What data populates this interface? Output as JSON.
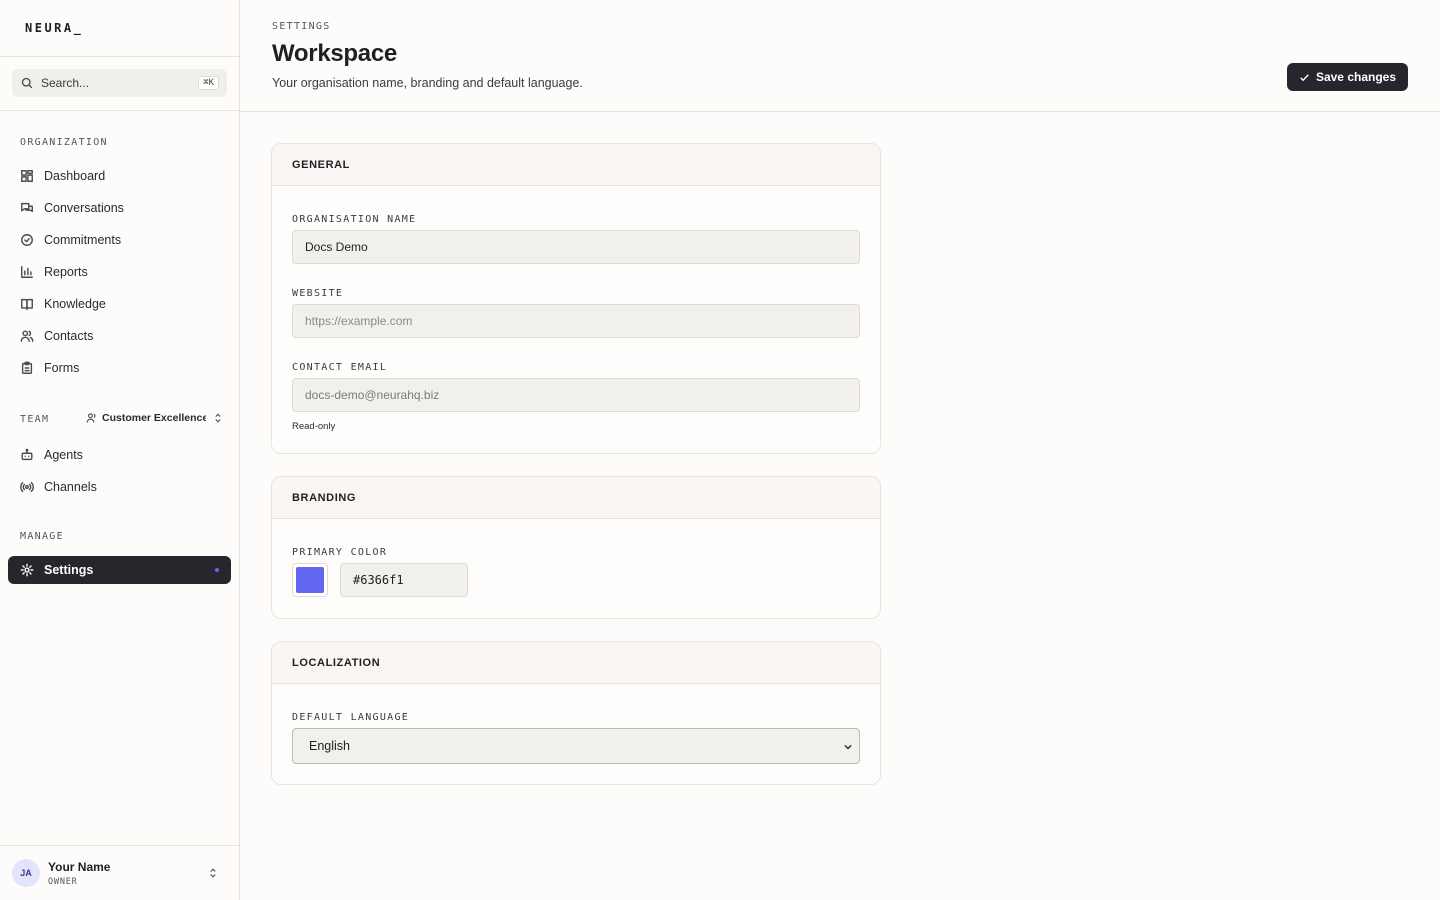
{
  "app": {
    "logo": "NEURA_"
  },
  "search": {
    "placeholder": "Search...",
    "shortcut": "⌘K"
  },
  "sidebar": {
    "org_label": "ORGANIZATION",
    "org_items": [
      {
        "label": "Dashboard",
        "icon": "dashboard-icon"
      },
      {
        "label": "Conversations",
        "icon": "chat-icon"
      },
      {
        "label": "Commitments",
        "icon": "check-circle-icon"
      },
      {
        "label": "Reports",
        "icon": "bar-chart-icon"
      },
      {
        "label": "Knowledge",
        "icon": "book-icon"
      },
      {
        "label": "Contacts",
        "icon": "users-icon"
      },
      {
        "label": "Forms",
        "icon": "clipboard-icon"
      }
    ],
    "team_label": "TEAM",
    "team_selected": "Customer Excellence",
    "team_items": [
      {
        "label": "Agents",
        "icon": "bot-icon"
      },
      {
        "label": "Channels",
        "icon": "radio-icon"
      }
    ],
    "manage_label": "MANAGE",
    "manage_items": [
      {
        "label": "Settings",
        "icon": "gear-icon",
        "active": true
      }
    ]
  },
  "user": {
    "initials": "JA",
    "name": "Your Name",
    "role": "OWNER"
  },
  "header": {
    "breadcrumb": "SETTINGS",
    "title": "Workspace",
    "subtitle": "Your organisation name, branding and default language.",
    "save_label": "Save changes"
  },
  "general": {
    "heading": "GENERAL",
    "org_name_label": "ORGANISATION NAME",
    "org_name_value": "Docs Demo",
    "website_label": "WEBSITE",
    "website_placeholder": "https://example.com",
    "email_label": "CONTACT EMAIL",
    "email_value": "docs-demo@neurahq.biz",
    "email_hint": "Read-only"
  },
  "branding": {
    "heading": "BRANDING",
    "color_label": "PRIMARY COLOR",
    "color_value": "#6366f1"
  },
  "localization": {
    "heading": "LOCALIZATION",
    "language_label": "DEFAULT LANGUAGE",
    "language_value": "English"
  },
  "colors": {
    "accent": "#6366f1",
    "dark": "#26262c"
  }
}
